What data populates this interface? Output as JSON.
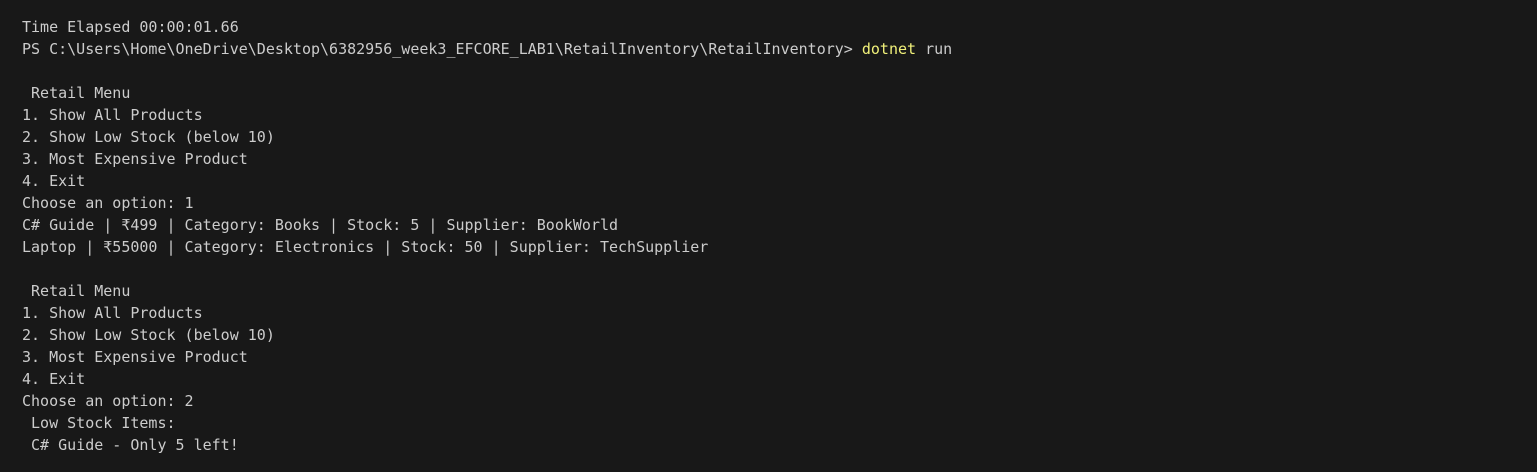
{
  "terminal": {
    "lines": [
      "Time Elapsed 00:00:01.66",
      "",
      "",
      " Retail Menu",
      "1. Show All Products",
      "2. Show Low Stock (below 10)",
      "3. Most Expensive Product",
      "4. Exit",
      "Choose an option: 1",
      "C# Guide | ₹499 | Category: Books | Stock: 5 | Supplier: BookWorld",
      "Laptop | ₹55000 | Category: Electronics | Stock: 50 | Supplier: TechSupplier",
      "",
      " Retail Menu",
      "1. Show All Products",
      "2. Show Low Stock (below 10)",
      "3. Most Expensive Product",
      "4. Exit",
      "Choose an option: 2",
      " Low Stock Items:",
      " C# Guide - Only 5 left!"
    ],
    "prompt": {
      "path": "PS C:\\Users\\Home\\OneDrive\\Desktop\\6382956_week3_EFCORE_LAB1\\RetailInventory\\RetailInventory> ",
      "command": "dotnet",
      "args": " run"
    }
  },
  "colors": {
    "background": "#181818",
    "text": "#cccccc",
    "command": "#f1f17a"
  }
}
